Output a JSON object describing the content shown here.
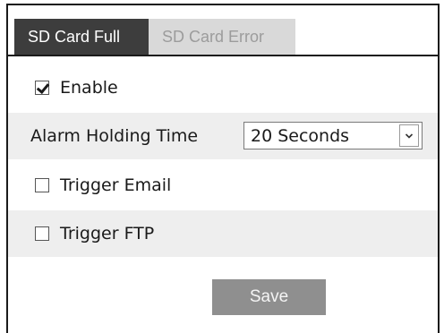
{
  "tabs": [
    {
      "label": "SD Card Full",
      "active": true
    },
    {
      "label": "SD Card Error",
      "active": false
    }
  ],
  "enable": {
    "label": "Enable",
    "checked": true
  },
  "alarm_holding_time": {
    "label": "Alarm Holding Time",
    "selected_value": "20 Seconds"
  },
  "trigger_email": {
    "label": "Trigger Email",
    "checked": false
  },
  "trigger_ftp": {
    "label": "Trigger FTP",
    "checked": false
  },
  "save_label": "Save",
  "colors": {
    "active_tab_bg": "#3d3d3d",
    "inactive_tab_bg": "#d9d9d9",
    "inactive_tab_text": "#9c9c9c",
    "row_shade": "#eeeeee",
    "save_button_bg": "#8f8f8f"
  },
  "icons": {
    "dropdown": "chevron-down-icon",
    "checkmark": "checkmark-icon"
  }
}
